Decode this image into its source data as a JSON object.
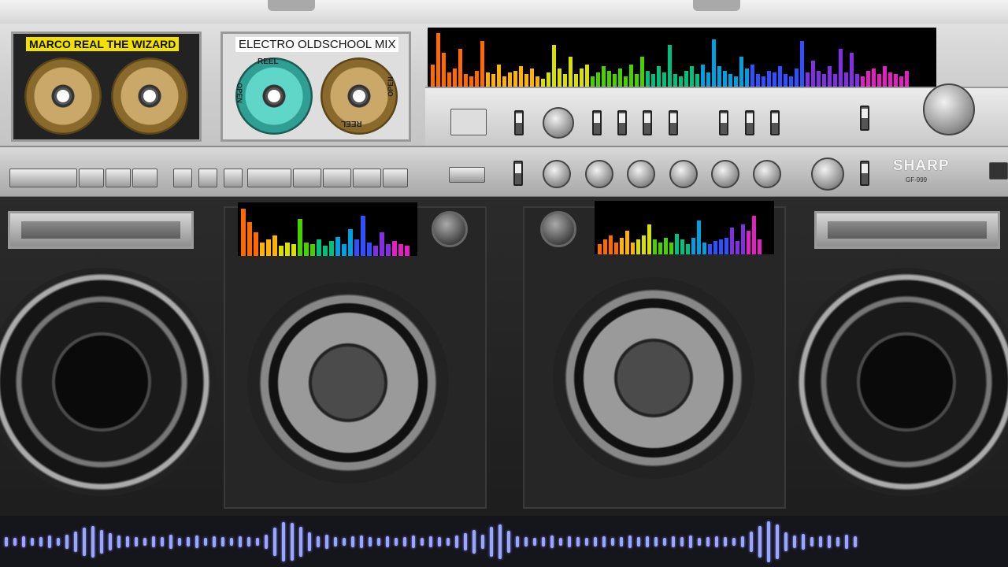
{
  "left_deck": {
    "label": "MARCO REAL THE WIZARD"
  },
  "right_deck": {
    "label": "ELECTRO OLDSCHOOL MIX",
    "reel_text_1": "REEL",
    "reel_text_2": "REEL",
    "reel_text_3": "OPEN",
    "reel_text_4": "OPEN"
  },
  "brand": {
    "name": "SHARP",
    "model": "GF-999"
  },
  "visualizer_colors": [
    "#ff6a00",
    "#ffb300",
    "#d9e000",
    "#48d000",
    "#00c080",
    "#00a0e0",
    "#3050ff",
    "#8030e0",
    "#e020c0"
  ],
  "visualizer_top": [
    30,
    70,
    45,
    20,
    25,
    50,
    18,
    15,
    22,
    60,
    20,
    18,
    30,
    15,
    20,
    22,
    28,
    18,
    25,
    15,
    12,
    20,
    55,
    25,
    18,
    40,
    18,
    25,
    30,
    15,
    20,
    28,
    22,
    18,
    25,
    15,
    30,
    18,
    40,
    22,
    18,
    28,
    20,
    55,
    18,
    15,
    22,
    28,
    18,
    30,
    20,
    62,
    28,
    22,
    18,
    15,
    40,
    25,
    30,
    18,
    15,
    22,
    20,
    28,
    18,
    15,
    25,
    60,
    20,
    35,
    22,
    18,
    28,
    18,
    50,
    20,
    45,
    18,
    15,
    22,
    25,
    18,
    28,
    20,
    18,
    15,
    22
  ],
  "visualizer_left": [
    70,
    50,
    35,
    20,
    25,
    30,
    15,
    20,
    18,
    55,
    20,
    18,
    25,
    15,
    22,
    28,
    18,
    40,
    25,
    60,
    20,
    15,
    35,
    18,
    22,
    18,
    15
  ],
  "visualizer_right": [
    15,
    22,
    28,
    18,
    25,
    35,
    18,
    22,
    28,
    45,
    22,
    18,
    25,
    18,
    30,
    22,
    15,
    25,
    50,
    18,
    15,
    20,
    22,
    25,
    40,
    20,
    45,
    35,
    58,
    22
  ],
  "waveform": [
    12,
    10,
    14,
    10,
    12,
    16,
    10,
    18,
    26,
    36,
    40,
    30,
    22,
    16,
    14,
    12,
    10,
    14,
    12,
    18,
    10,
    12,
    16,
    10,
    14,
    12,
    10,
    14,
    12,
    10,
    18,
    36,
    50,
    48,
    38,
    24,
    14,
    18,
    12,
    10,
    14,
    16,
    12,
    10,
    14,
    10,
    12,
    16,
    10,
    14,
    12,
    10,
    16,
    22,
    30,
    18,
    38,
    44,
    28,
    14,
    12,
    10,
    12,
    16,
    10,
    14,
    12,
    10,
    12,
    14,
    10,
    12,
    16,
    12,
    14,
    12,
    10,
    14,
    12,
    16,
    10,
    12,
    14,
    12,
    10,
    14,
    26,
    40,
    52,
    44,
    24,
    16,
    20,
    12,
    14,
    16,
    12,
    18,
    14
  ]
}
